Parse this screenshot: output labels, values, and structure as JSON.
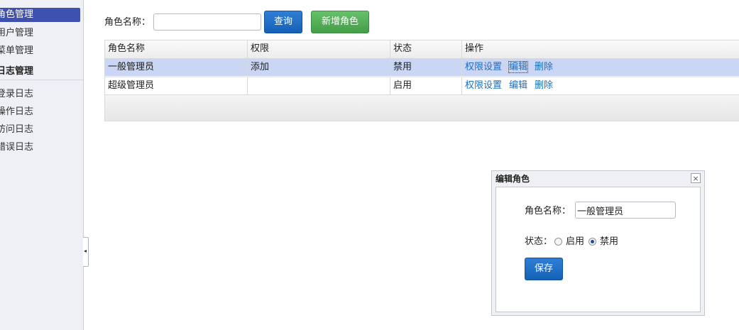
{
  "sidebar": {
    "items": [
      {
        "label": "角色管理",
        "active": true
      },
      {
        "label": "用户管理",
        "active": false
      },
      {
        "label": "菜单管理",
        "active": false
      }
    ],
    "section_title": "日志管理",
    "log_items": [
      {
        "label": "登录日志"
      },
      {
        "label": "操作日志"
      },
      {
        "label": "访问日志"
      },
      {
        "label": "错误日志"
      }
    ],
    "collapse_glyph": "◂"
  },
  "search": {
    "label": "角色名称：",
    "value": "",
    "placeholder": "",
    "query_button": "查询",
    "add_button": "新增角色"
  },
  "table": {
    "columns": [
      "角色名称",
      "权限",
      "状态",
      "操作"
    ],
    "rows": [
      {
        "name": "一般管理员",
        "permission": "添加",
        "status": "禁用",
        "actions": [
          "权限设置",
          "编辑",
          "删除"
        ]
      },
      {
        "name": "超级管理员",
        "permission": "",
        "status": "启用",
        "actions": [
          "权限设置",
          "编辑",
          "删除"
        ]
      }
    ]
  },
  "dialog": {
    "title": "编辑角色",
    "close_glyph": "×",
    "name_label": "角色名称：",
    "name_value": "一般管理员",
    "status_label": "状态：",
    "status_options": [
      "启用",
      "禁用"
    ],
    "status_selected": "禁用",
    "save_button": "保存"
  },
  "colors": {
    "accent": "#3f51b0",
    "primary_button": "#1561b7",
    "success_button": "#449e48",
    "selected_row": "#cbd6f5",
    "link": "#1b6fc2"
  }
}
